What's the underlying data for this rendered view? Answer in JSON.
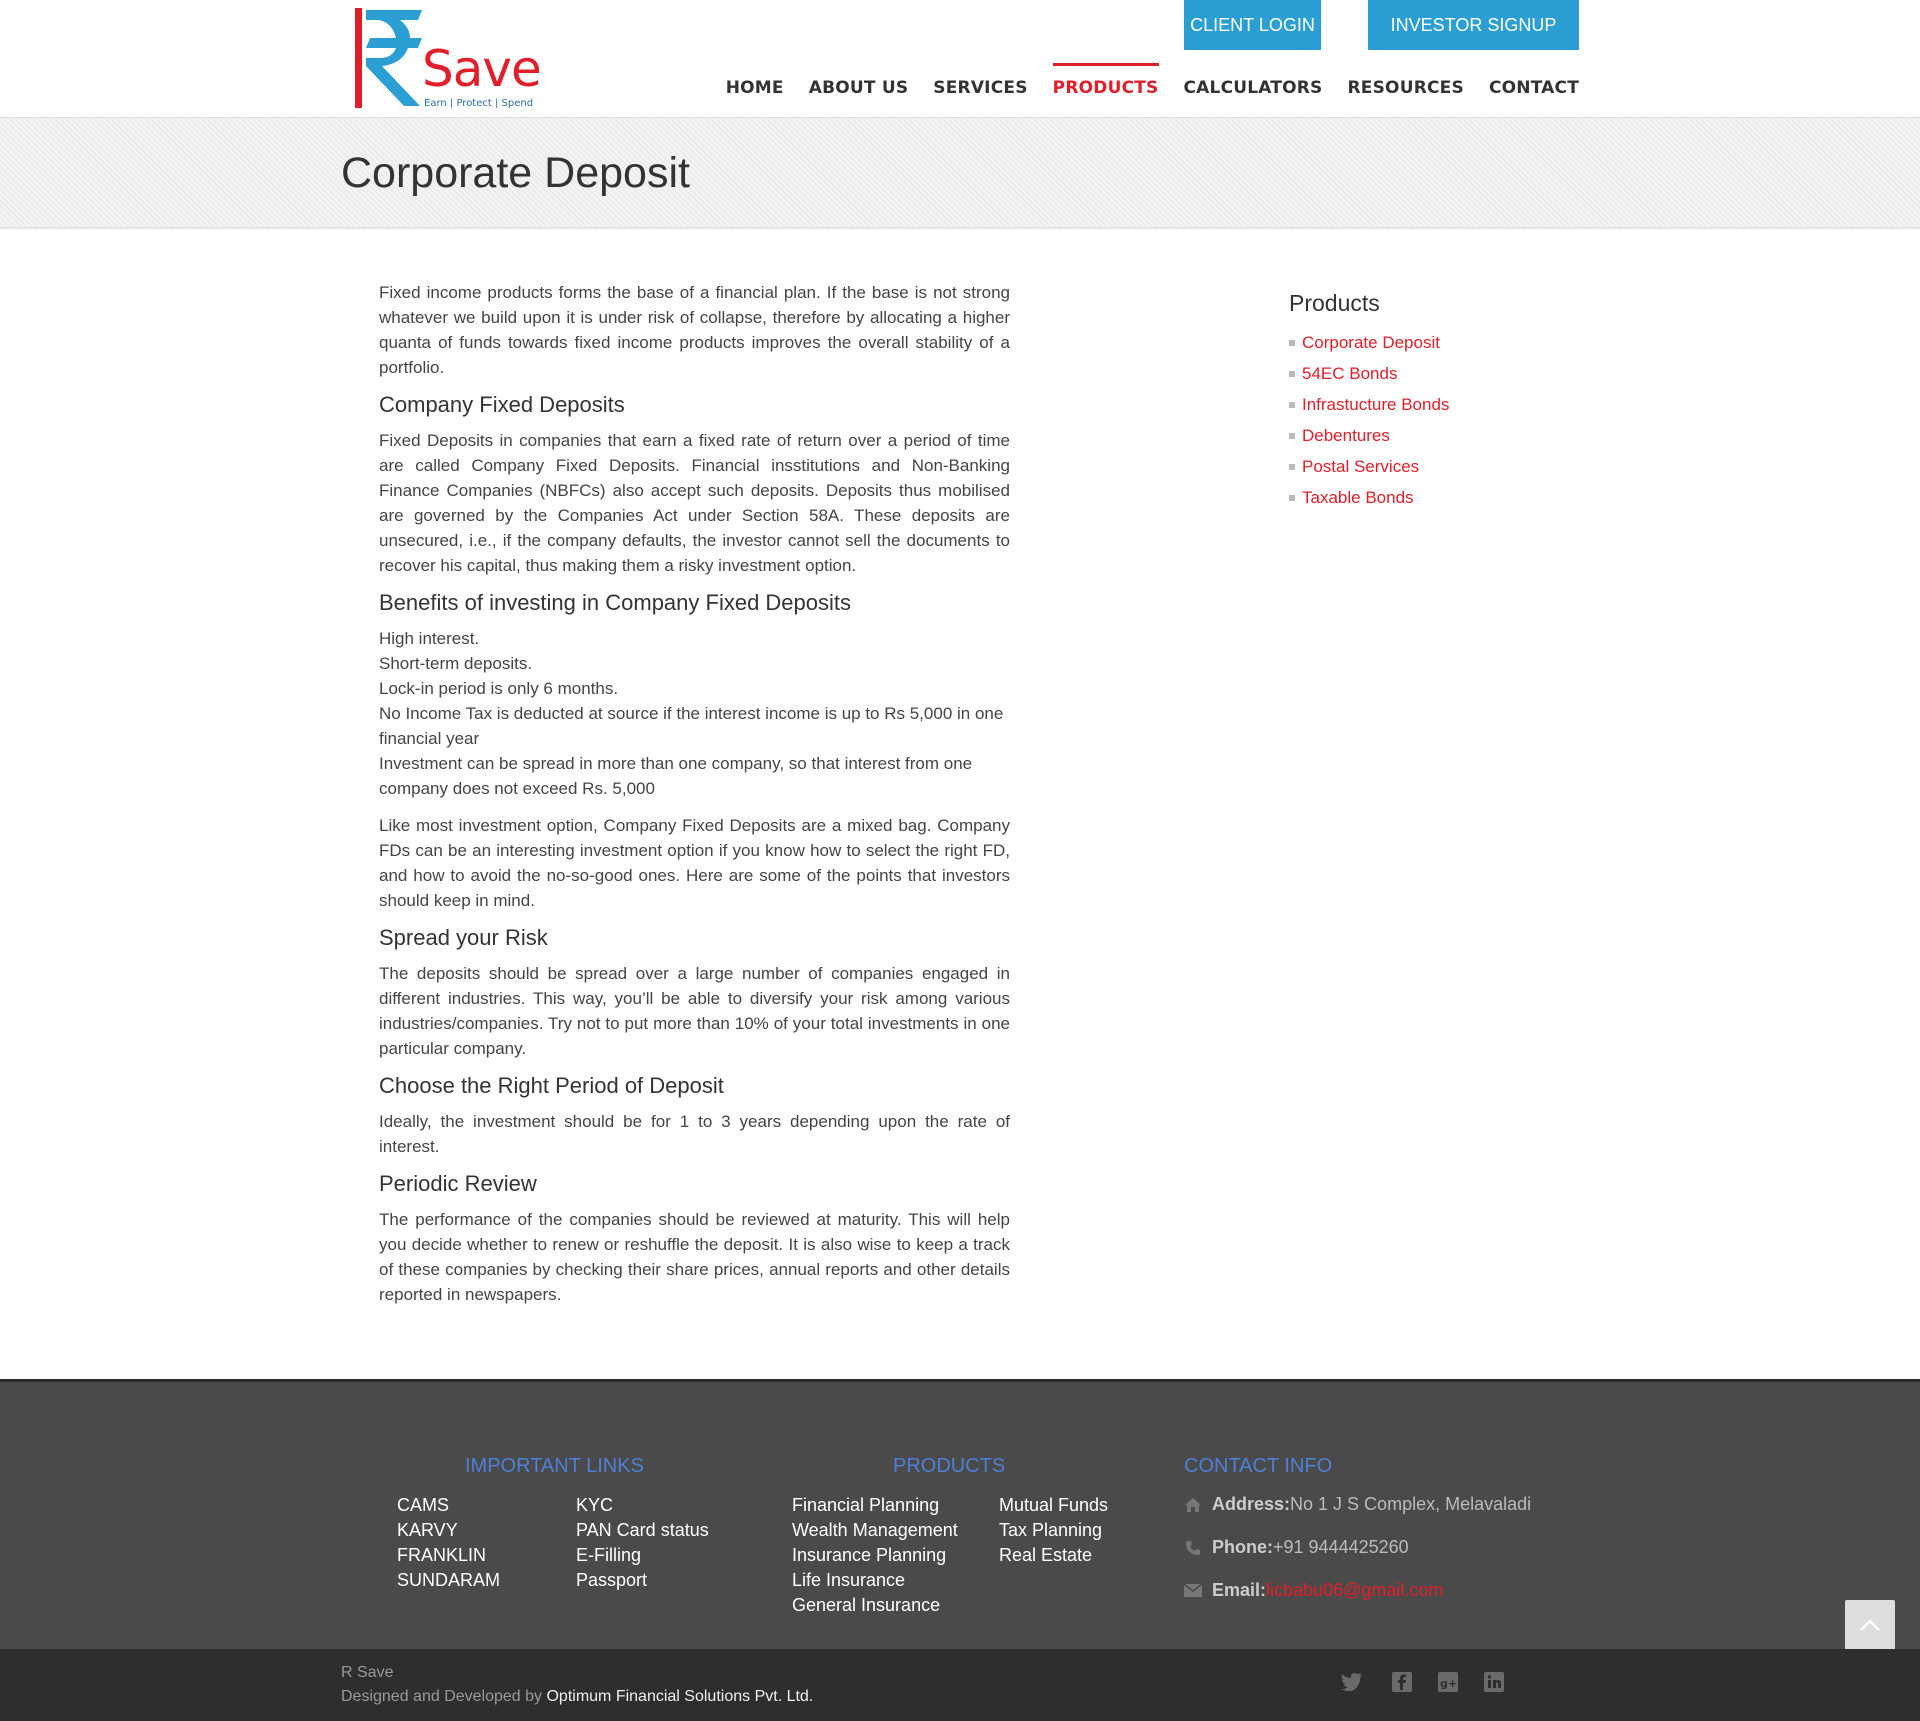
{
  "brand": {
    "name": "Save",
    "tagline": "Earn | Protect | Spend",
    "primary_color": "#e01f2a",
    "accent_color": "#2b9fd3"
  },
  "top_buttons": {
    "client_login": "CLIENT LOGIN",
    "investor_signup": "INVESTOR SIGNUP"
  },
  "nav": [
    "HOME",
    "ABOUT US",
    "SERVICES",
    "PRODUCTS",
    "CALCULATORS",
    "RESOURCES",
    "CONTACT"
  ],
  "nav_active": "PRODUCTS",
  "page_title": "Corporate Deposit",
  "content": {
    "intro": "Fixed income products forms the base of a financial plan. If the base is not strong whatever we build upon it is under risk of collapse, therefore by allocating a higher quanta of funds towards fixed income products improves the overall stability of a portfolio.",
    "h_company_fd": "Company Fixed Deposits",
    "p_company_fd": "Fixed Deposits in companies that earn a fixed rate of return over a period of time are called Company Fixed Deposits. Financial insstitutions and Non-Banking Finance Companies (NBFCs) also accept such deposits. Deposits thus mobilised are governed by the Companies Act under Section 58A. These deposits are unsecured, i.e., if the company defaults, the investor cannot sell the documents to recover his capital, thus making them a risky investment option.",
    "h_benefits": "Benefits of investing in Company Fixed Deposits",
    "benefits": [
      "High interest.",
      "Short-term deposits.",
      "Lock-in period is only 6 months.",
      "No Income Tax is deducted at source if the interest income is up to Rs 5,000 in one financial year",
      "Investment can be spread in more than one company, so that interest from one company does not exceed Rs. 5,000"
    ],
    "p_mixed_bag": "Like most investment option, Company Fixed Deposits are a mixed bag. Company FDs can be an interesting investment option if you know how to select the right FD, and how to avoid the no-so-good ones. Here are some of the points that investors should keep in mind.",
    "h_spread": "Spread your Risk",
    "p_spread": "The deposits should be spread over a large number of companies engaged in different industries. This way, you’ll be able to diversify your risk among various industries/companies. Try not to put more than 10% of your total investments in one particular company.",
    "h_period": "Choose the Right Period of Deposit",
    "p_period": "Ideally, the investment should be for 1 to 3 years depending upon the rate of interest.",
    "h_review": "Periodic Review",
    "p_review": "The performance of the companies should be reviewed at maturity. This will help you decide whether to renew or reshuffle the deposit. It is also wise to keep a track of these companies by checking their share prices, annual reports and other details reported in newspapers."
  },
  "sidebar": {
    "title": "Products",
    "items": [
      "Corporate Deposit",
      "54EC Bonds",
      "Infrastucture Bonds",
      "Debentures",
      "Postal Services",
      "Taxable Bonds"
    ]
  },
  "footer": {
    "important_links_title": "IMPORTANT LINKS",
    "important_links_col1": [
      "CAMS",
      "KARVY",
      "FRANKLIN",
      "SUNDARAM"
    ],
    "important_links_col2": [
      "KYC",
      "PAN Card status",
      "E-Filling",
      "Passport"
    ],
    "products_title": "PRODUCTS",
    "products_col1": [
      "Financial Planning",
      "Wealth Management",
      "Insurance Planning",
      "Life Insurance",
      "General Insurance"
    ],
    "products_col2": [
      "Mutual Funds",
      "Tax Planning",
      "Real Estate"
    ],
    "contact_title": "CONTACT INFO",
    "address_label": "Address:",
    "address_value": "No 1 J S Complex, Melavaladi",
    "phone_label": "Phone:",
    "phone_value": "+91 9444425260",
    "email_label": "Email: ",
    "email_value": "licbabu06@gmail.com"
  },
  "bottom": {
    "site_name": "R Save",
    "designed_by_prefix": "Designed and Developed by ",
    "developer": "Optimum Financial Solutions Pvt. Ltd.",
    "social_icons": [
      "twitter-icon",
      "facebook-icon",
      "google-plus-icon",
      "linkedin-icon"
    ]
  }
}
